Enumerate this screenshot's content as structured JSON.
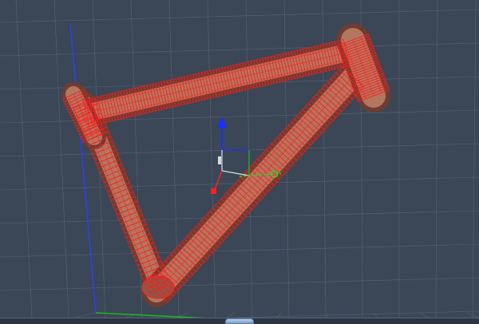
{
  "viewport": {
    "name": "",
    "model": "bicycle-frame",
    "render_mode": "wireframe-on-shaded",
    "background": "#3b4656",
    "grid_color": "#6e7b8e",
    "wire_color": "#ff1c1c",
    "tube_color": "#a66a57"
  },
  "axes": {
    "x_color": "#18c018",
    "y_color": "#2840ff",
    "z_color": "#ff2020"
  },
  "gizmo": {
    "icon": "translate-gizmo-icon"
  },
  "scrollbar": {
    "icon": "scroll-thumb"
  }
}
